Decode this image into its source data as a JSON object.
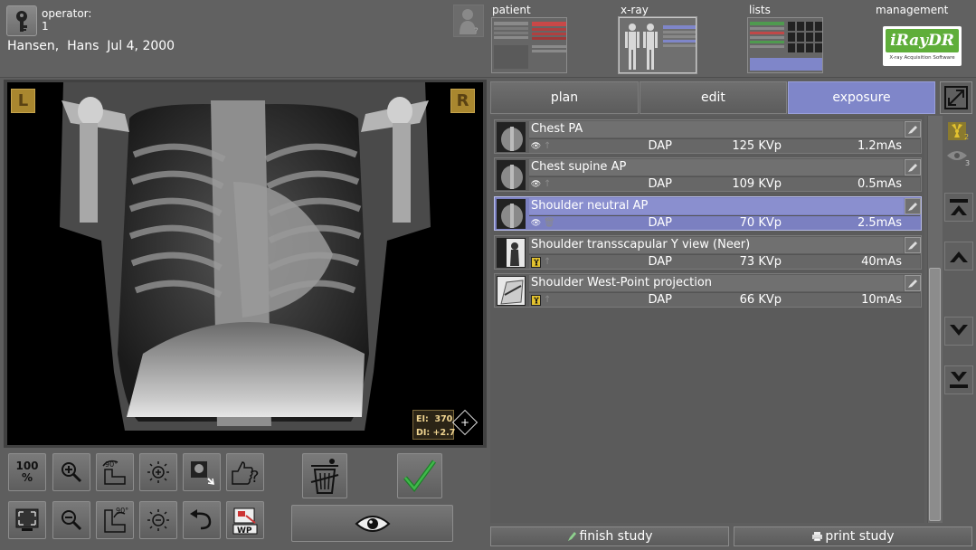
{
  "header": {
    "operator_label": "operator:",
    "operator_number": "1",
    "patient_name": "Hansen,  Hans",
    "patient_dob": "Jul 4, 2000"
  },
  "nav": {
    "patient": "patient",
    "xray": "x-ray",
    "lists": "lists",
    "management": "management"
  },
  "logo": {
    "name": "iRayDR",
    "subtitle": "X-ray Acquisition Software"
  },
  "viewer": {
    "left_marker": "L",
    "right_marker": "R",
    "ei_label": "EI:",
    "ei_value": "370",
    "di_label": "DI:",
    "di_value": "+2.7",
    "zoom_line1": "100",
    "zoom_line2": "%",
    "rotate_cw_label": "90°",
    "rotate_ccw_label": "90°",
    "wp_label": "WP"
  },
  "tabs": [
    "plan",
    "edit",
    "exposure"
  ],
  "active_tab": "exposure",
  "exposures": [
    {
      "name": "Chest PA",
      "dap": "DAP",
      "kvp": "125 KVp",
      "mas": "1.2mAs",
      "status": "viewed",
      "selected": false
    },
    {
      "name": "Chest supine AP",
      "dap": "DAP",
      "kvp": "109 KVp",
      "mas": "0.5mAs",
      "status": "viewed",
      "selected": false
    },
    {
      "name": "Shoulder neutral AP",
      "dap": "DAP",
      "kvp": "70 KVp",
      "mas": "2.5mAs",
      "status": "viewed",
      "selected": true
    },
    {
      "name": "Shoulder transscapular Y view (Neer)",
      "dap": "DAP",
      "kvp": "73 KVp",
      "mas": "40mAs",
      "status": "pending",
      "selected": false
    },
    {
      "name": "Shoulder West-Point projection",
      "dap": "DAP",
      "kvp": "66 KVp",
      "mas": "10mAs",
      "status": "pending",
      "selected": false
    }
  ],
  "side": {
    "radiation_count": "2",
    "viewed_count": "3"
  },
  "footer": {
    "finish_study": "finish study",
    "print_study": "print study"
  },
  "colors": {
    "accent": "#7f86c9",
    "marker": "#a9872f",
    "logo_green": "#5fae3a",
    "check_green": "#2f9a3a"
  }
}
